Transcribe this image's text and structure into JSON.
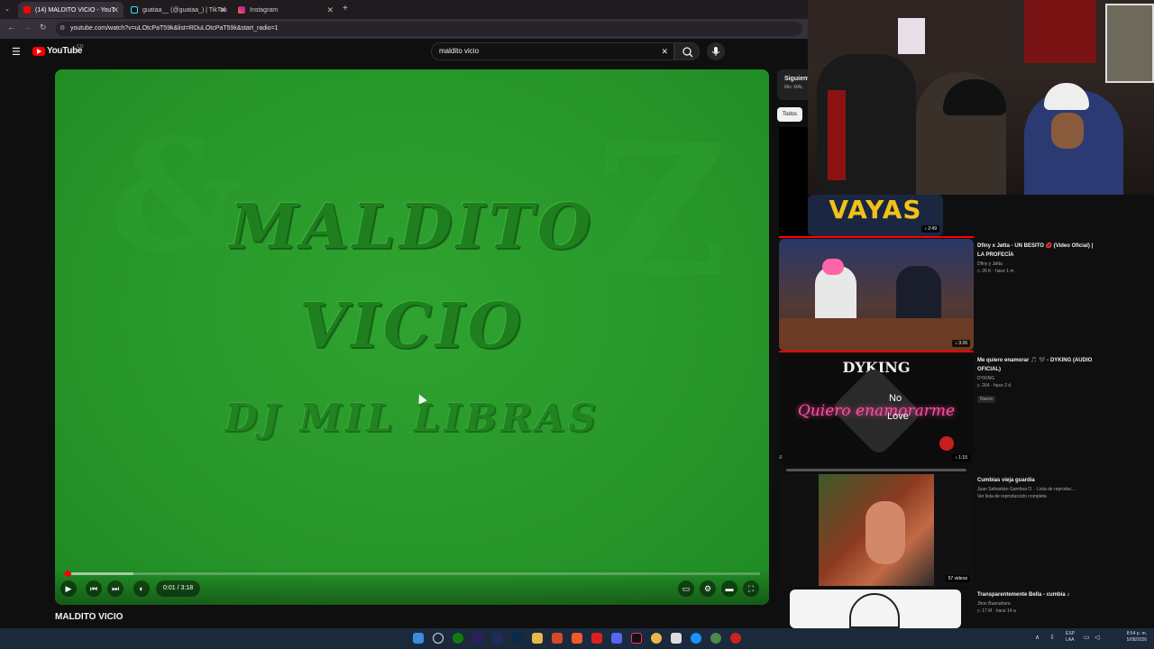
{
  "browser": {
    "tabs": [
      {
        "label": "(14) MALDITO VICIO - YouT",
        "active": true
      },
      {
        "label": "guataa__ (@guataa_) | TikTok",
        "active": false
      },
      {
        "label": "Instagram",
        "active": false
      }
    ],
    "new_tab": "+",
    "url": "youtube.com/watch?v=uLOtcPaT59k&list=RDuLOtcPaT59k&start_radio=1"
  },
  "youtube": {
    "logo": "YouTube",
    "country": "CO",
    "search_value": "maldito vicio",
    "clear": "✕"
  },
  "player": {
    "art_line1": "MALDITO",
    "art_line2": "VICIO",
    "art_line3": "DJ MIL LIBRAS",
    "time": "0:01 / 3:18",
    "progress_fraction": 0.005,
    "buffer_fraction": 0.1
  },
  "video_title": "MALDITO VICIO",
  "sidebar": {
    "next_title": "Siguient",
    "next_sub": "Mix: MAL",
    "chip": "Todos",
    "items": [
      {
        "thumb_text": "VAYAS",
        "duration": "♪ 2:49"
      },
      {
        "title": "Dfiny x Jøtta - UN BESITO 💋 (Video Oficial) | LA PROFECÍA",
        "channel": "Dfiny y Jøtta",
        "stats": "▷ 26 K · hace 1 m",
        "duration": "♪ 3:26"
      },
      {
        "title": "Me quiero enamorar 🎵 🖤 - DYKING (AUDIO OFICIAL)",
        "channel": "DYKING",
        "stats": "▷ 264 · hace 2 d",
        "badge": "Nuevo",
        "duration": "♪ 1:15",
        "thumb_top": "DYKING",
        "thumb_main": "Quiero enamorarme",
        "thumb_no": "No",
        "thumb_love": "Love"
      },
      {
        "title": "Cumbias vieja guardia",
        "channel": "Juan Sebastián Gamboa O. · Lista de reproduc...",
        "stats": "Ver lista de reproducción completa",
        "duration": "57 videos"
      },
      {
        "title": "Transparentemente Bella - cumbia ♪",
        "channel": "Jhon Buenahora",
        "stats": "▷ 17 M · hace 14 a"
      }
    ]
  },
  "taskbar": {
    "lang": "ESP\nLAA",
    "time": "8:54 p. m.",
    "date": "5/08/2026"
  }
}
